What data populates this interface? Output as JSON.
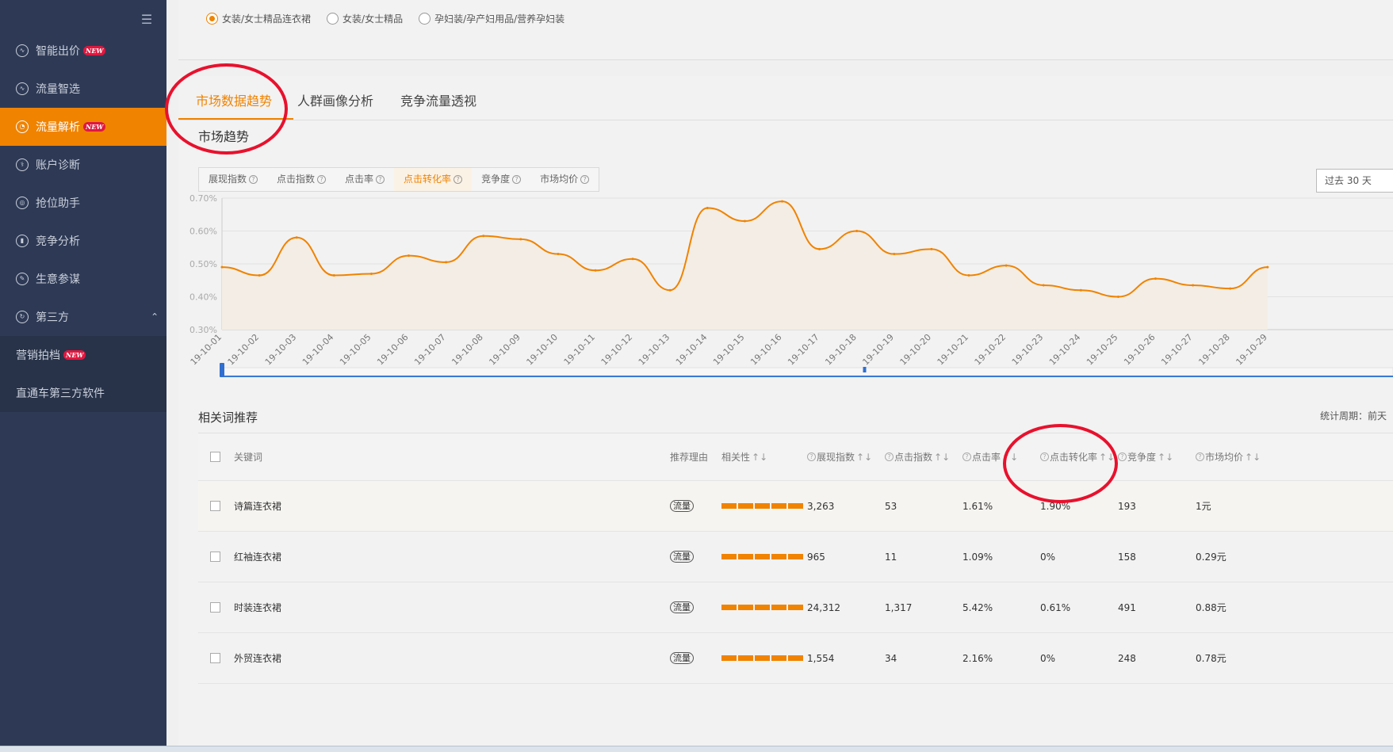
{
  "sidebar": {
    "items": [
      {
        "label": "智能出价",
        "icon": "pulse-icon",
        "new": true
      },
      {
        "label": "流量智选",
        "icon": "pulse-icon",
        "new": false
      },
      {
        "label": "流量解析",
        "icon": "gauge-icon",
        "new": true,
        "active": true
      },
      {
        "label": "账户诊断",
        "icon": "stethoscope-icon",
        "new": false
      },
      {
        "label": "抢位助手",
        "icon": "target-icon",
        "new": false
      },
      {
        "label": "竞争分析",
        "icon": "bar-chart-icon",
        "new": false
      },
      {
        "label": "生意参谋",
        "icon": "compass-icon",
        "new": false
      },
      {
        "label": "第三方",
        "icon": "refresh-icon",
        "new": false,
        "expanded": true
      }
    ],
    "sub_items": [
      {
        "label": "营销拍档",
        "new": true
      },
      {
        "label": "直通车第三方软件",
        "new": false
      }
    ],
    "new_badge": "NEW"
  },
  "categories": {
    "options": [
      "女装/女士精品连衣裙",
      "女装/女士精品",
      "孕妇装/孕产妇用品/营养孕妇装"
    ],
    "selected": 0
  },
  "tabs": [
    "市场数据趋势",
    "人群画像分析",
    "竞争流量透视"
  ],
  "active_tab": 0,
  "trend": {
    "title": "市场趋势",
    "metrics": [
      "展现指数",
      "点击指数",
      "点击率",
      "点击转化率",
      "竞争度",
      "市场均价"
    ],
    "active_metric": 3,
    "period": "过去 30 天"
  },
  "chart_data": {
    "type": "area",
    "series": [
      {
        "values": [
          0.49,
          0.465,
          0.58,
          0.465,
          0.47,
          0.525,
          0.505,
          0.585,
          0.575,
          0.53,
          0.48,
          0.515,
          0.42,
          0.67,
          0.63,
          0.69,
          0.545,
          0.6,
          0.53,
          0.545,
          0.465,
          0.495,
          0.435,
          0.42,
          0.4,
          0.455,
          0.435,
          0.425,
          0.49
        ]
      }
    ],
    "x": [
      "19-10-01",
      "19-10-02",
      "19-10-03",
      "19-10-04",
      "19-10-05",
      "19-10-06",
      "19-10-07",
      "19-10-08",
      "19-10-09",
      "19-10-10",
      "19-10-11",
      "19-10-12",
      "19-10-13",
      "19-10-14",
      "19-10-15",
      "19-10-16",
      "19-10-17",
      "19-10-18",
      "19-10-19",
      "19-10-20",
      "19-10-21",
      "19-10-22",
      "19-10-23",
      "19-10-24",
      "19-10-25",
      "19-10-26",
      "19-10-27",
      "19-10-28",
      "19-10-29"
    ],
    "y_ticks": [
      "0.70%",
      "0.60%",
      "0.50%",
      "0.40%",
      "0.30%"
    ],
    "ylim": [
      0.3,
      0.7
    ],
    "grid": true,
    "color": "#f08300"
  },
  "keywords": {
    "title": "相关词推荐",
    "stat_period": "统计周期：前天",
    "columns": [
      "关键词",
      "推荐理由",
      "相关性",
      "展现指数",
      "点击指数",
      "点击率",
      "点击转化率",
      "竞争度",
      "市场均价"
    ],
    "sort_glyph": "↑↓",
    "help_glyph": "?",
    "reason_tag": "流量",
    "rows": [
      {
        "keyword": "诗篇连衣裙",
        "relevance": 5,
        "impressions": "3,263",
        "clicks": "53",
        "ctr": "1.61%",
        "cvr": "1.90%",
        "competition": "193",
        "price": "1元"
      },
      {
        "keyword": "红袖连衣裙",
        "relevance": 5,
        "impressions": "965",
        "clicks": "11",
        "ctr": "1.09%",
        "cvr": "0%",
        "competition": "158",
        "price": "0.29元"
      },
      {
        "keyword": "时装连衣裙",
        "relevance": 5,
        "impressions": "24,312",
        "clicks": "1,317",
        "ctr": "5.42%",
        "cvr": "0.61%",
        "competition": "491",
        "price": "0.88元"
      },
      {
        "keyword": "外贸连衣裙",
        "relevance": 5,
        "impressions": "1,554",
        "clicks": "34",
        "ctr": "2.16%",
        "cvr": "0%",
        "competition": "248",
        "price": "0.78元"
      }
    ]
  },
  "colors": {
    "accent": "#f08300",
    "sidebar": "#2e3a55",
    "annotation": "#e8112d"
  }
}
